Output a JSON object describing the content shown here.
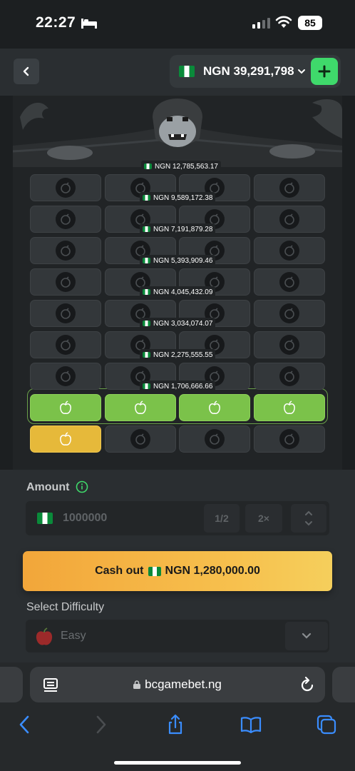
{
  "status_bar": {
    "time": "22:27",
    "battery": "85"
  },
  "header": {
    "currency_code": "NGN",
    "balance": "NGN 39,291,798"
  },
  "game": {
    "multipliers": [
      "NGN 12,785,563.17",
      "NGN 9,589,172.38",
      "NGN 7,191,879.28",
      "NGN 5,393,909.46",
      "NGN 4,045,432.09",
      "NGN 3,034,074.07",
      "NGN 2,275,555.55",
      "NGN 1,706,666.66"
    ],
    "rows": [
      [
        "bomb",
        "bomb",
        "bomb",
        "bomb"
      ],
      [
        "bomb",
        "bomb",
        "bomb",
        "bomb"
      ],
      [
        "bomb",
        "bomb",
        "bomb",
        "bomb"
      ],
      [
        "bomb",
        "bomb",
        "bomb",
        "bomb"
      ],
      [
        "bomb",
        "bomb",
        "bomb",
        "bomb"
      ],
      [
        "bomb",
        "bomb",
        "bomb",
        "bomb"
      ],
      [
        "bomb",
        "bomb",
        "bomb",
        "bomb"
      ],
      [
        "apple-win",
        "apple-win",
        "apple-win",
        "apple-win"
      ],
      [
        "apple-picked",
        "bomb",
        "bomb",
        "bomb"
      ]
    ]
  },
  "bet_panel": {
    "amount_label": "Amount",
    "amount_value": "1000000",
    "half_label": "1/2",
    "double_label": "2×",
    "cashout_prefix": "Cash out",
    "cashout_amount": "NGN 1,280,000.00",
    "difficulty_label": "Select Difficulty",
    "difficulty_value": "Easy"
  },
  "browser": {
    "url": "bcgamebet.ng"
  },
  "colors": {
    "win": "#7bc24a",
    "picked": "#e6b93a",
    "cashout": "#f7c14e",
    "deposit": "#3fd96b"
  }
}
